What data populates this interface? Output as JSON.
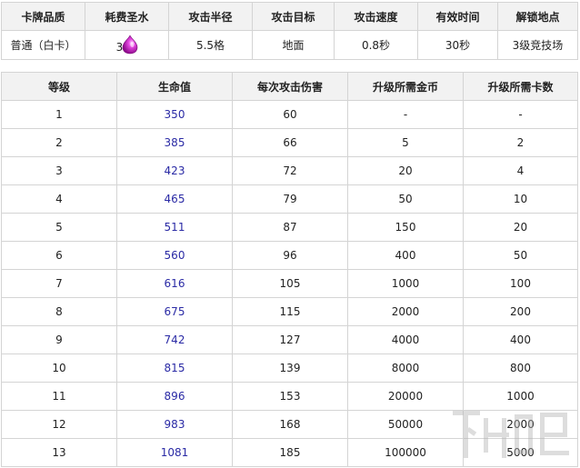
{
  "card_info": {
    "headers": [
      "卡牌品质",
      "耗费圣水",
      "攻击半径",
      "攻击目标",
      "攻击速度",
      "有效时间",
      "解锁地点"
    ],
    "quality": "普通（白卡）",
    "cost": "3",
    "cost_icon": "elixir-drop-icon",
    "range": "5.5格",
    "target": "地面",
    "speed": "0.8秒",
    "duration": "30秒",
    "unlock": "3级竞技场"
  },
  "level_table": {
    "headers": [
      "等级",
      "生命值",
      "每次攻击伤害",
      "升级所需金币",
      "升级所需卡数"
    ],
    "rows": [
      [
        "1",
        "350",
        "60",
        "-",
        "-"
      ],
      [
        "2",
        "385",
        "66",
        "5",
        "2"
      ],
      [
        "3",
        "423",
        "72",
        "20",
        "4"
      ],
      [
        "4",
        "465",
        "79",
        "50",
        "10"
      ],
      [
        "5",
        "511",
        "87",
        "150",
        "20"
      ],
      [
        "6",
        "560",
        "96",
        "400",
        "50"
      ],
      [
        "7",
        "616",
        "105",
        "1000",
        "100"
      ],
      [
        "8",
        "675",
        "115",
        "2000",
        "200"
      ],
      [
        "9",
        "742",
        "127",
        "4000",
        "400"
      ],
      [
        "10",
        "815",
        "139",
        "8000",
        "800"
      ],
      [
        "11",
        "896",
        "153",
        "20000",
        "1000"
      ],
      [
        "12",
        "983",
        "168",
        "50000",
        "2000"
      ],
      [
        "13",
        "1081",
        "185",
        "100000",
        "5000"
      ]
    ]
  },
  "colors": {
    "red": "#c8161d",
    "blue": "#2a2aa5",
    "elixir": "#d41fd0"
  }
}
